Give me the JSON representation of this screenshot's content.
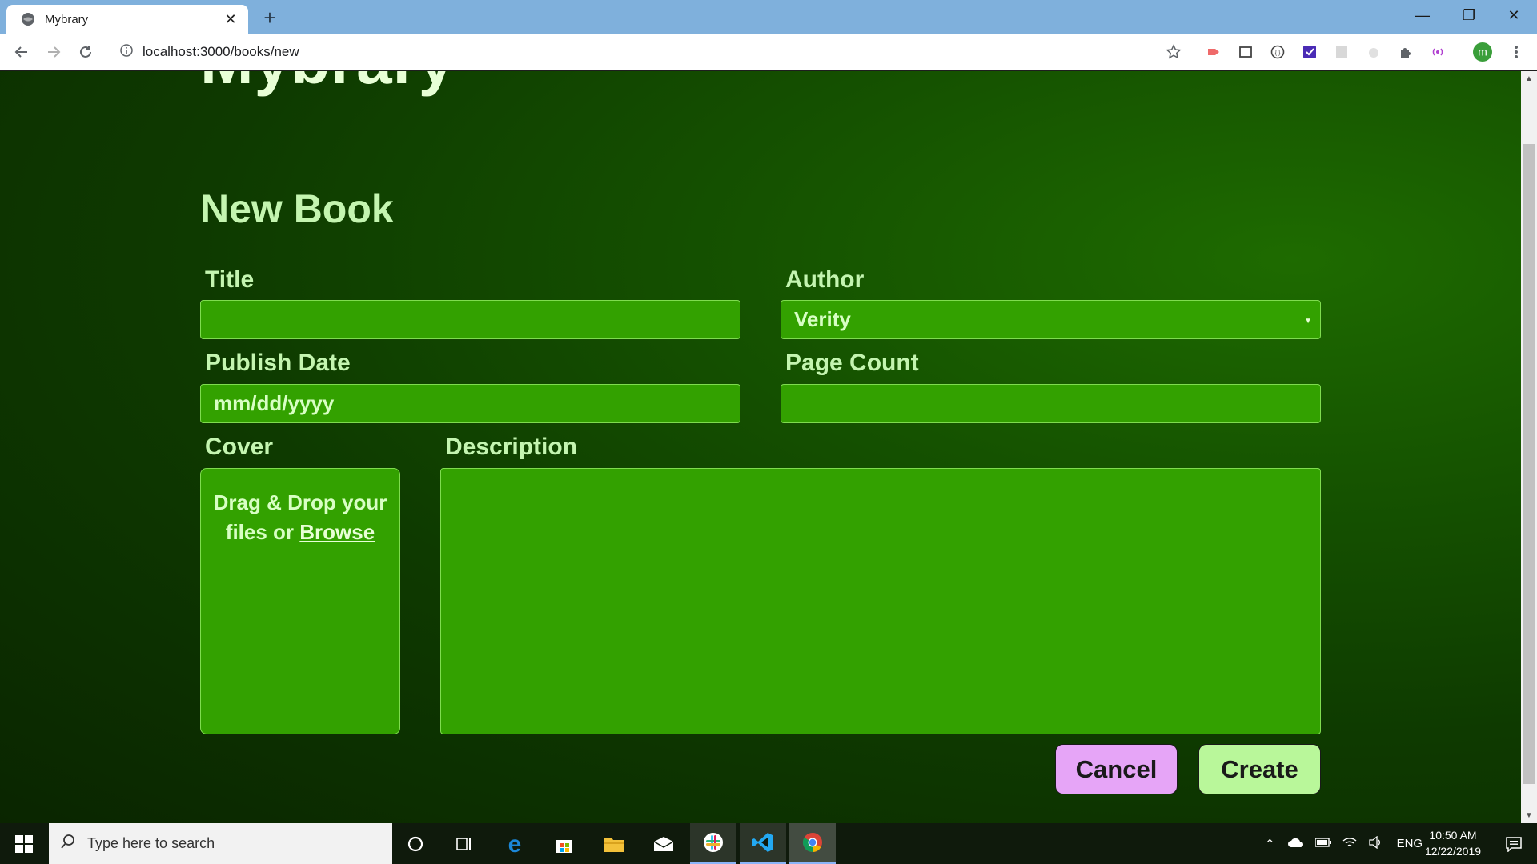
{
  "browser": {
    "tab_title": "Mybrary",
    "url": "localhost:3000/books/new"
  },
  "page": {
    "brand": "Mybrary",
    "heading": "New Book",
    "form": {
      "title_label": "Title",
      "title_value": "",
      "author_label": "Author",
      "author_selected": "Verity",
      "publish_date_label": "Publish Date",
      "publish_date_placeholder": "mm/dd/yyyy",
      "page_count_label": "Page Count",
      "page_count_value": "",
      "cover_label": "Cover",
      "cover_drop_text": "Drag & Drop your files or",
      "cover_browse_link": "Browse",
      "description_label": "Description",
      "description_value": ""
    },
    "buttons": {
      "cancel": "Cancel",
      "create": "Create"
    }
  },
  "taskbar": {
    "search_placeholder": "Type here to search",
    "language": "ENG",
    "time": "10:50 AM",
    "date": "12/22/2019"
  },
  "colors": {
    "field_bg": "#33a100",
    "label_text": "#c4f5b0",
    "cancel_bg": "#e6a5f7",
    "create_bg": "#b9f79a"
  }
}
